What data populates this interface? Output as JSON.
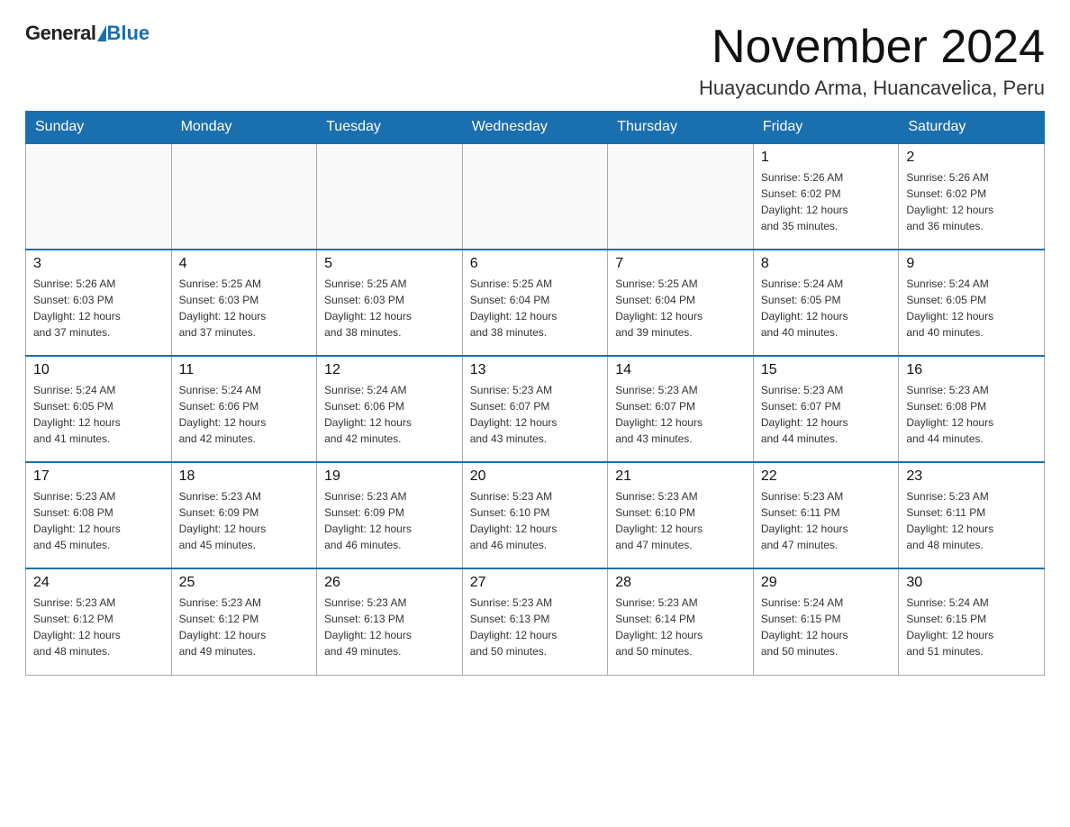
{
  "header": {
    "logo_general": "General",
    "logo_blue": "Blue",
    "main_title": "November 2024",
    "subtitle": "Huayacundo Arma, Huancavelica, Peru"
  },
  "calendar": {
    "days_of_week": [
      "Sunday",
      "Monday",
      "Tuesday",
      "Wednesday",
      "Thursday",
      "Friday",
      "Saturday"
    ],
    "weeks": [
      [
        {
          "num": "",
          "info": "",
          "empty": true
        },
        {
          "num": "",
          "info": "",
          "empty": true
        },
        {
          "num": "",
          "info": "",
          "empty": true
        },
        {
          "num": "",
          "info": "",
          "empty": true
        },
        {
          "num": "",
          "info": "",
          "empty": true
        },
        {
          "num": "1",
          "info": "Sunrise: 5:26 AM\nSunset: 6:02 PM\nDaylight: 12 hours\nand 35 minutes.",
          "empty": false
        },
        {
          "num": "2",
          "info": "Sunrise: 5:26 AM\nSunset: 6:02 PM\nDaylight: 12 hours\nand 36 minutes.",
          "empty": false
        }
      ],
      [
        {
          "num": "3",
          "info": "Sunrise: 5:26 AM\nSunset: 6:03 PM\nDaylight: 12 hours\nand 37 minutes.",
          "empty": false
        },
        {
          "num": "4",
          "info": "Sunrise: 5:25 AM\nSunset: 6:03 PM\nDaylight: 12 hours\nand 37 minutes.",
          "empty": false
        },
        {
          "num": "5",
          "info": "Sunrise: 5:25 AM\nSunset: 6:03 PM\nDaylight: 12 hours\nand 38 minutes.",
          "empty": false
        },
        {
          "num": "6",
          "info": "Sunrise: 5:25 AM\nSunset: 6:04 PM\nDaylight: 12 hours\nand 38 minutes.",
          "empty": false
        },
        {
          "num": "7",
          "info": "Sunrise: 5:25 AM\nSunset: 6:04 PM\nDaylight: 12 hours\nand 39 minutes.",
          "empty": false
        },
        {
          "num": "8",
          "info": "Sunrise: 5:24 AM\nSunset: 6:05 PM\nDaylight: 12 hours\nand 40 minutes.",
          "empty": false
        },
        {
          "num": "9",
          "info": "Sunrise: 5:24 AM\nSunset: 6:05 PM\nDaylight: 12 hours\nand 40 minutes.",
          "empty": false
        }
      ],
      [
        {
          "num": "10",
          "info": "Sunrise: 5:24 AM\nSunset: 6:05 PM\nDaylight: 12 hours\nand 41 minutes.",
          "empty": false
        },
        {
          "num": "11",
          "info": "Sunrise: 5:24 AM\nSunset: 6:06 PM\nDaylight: 12 hours\nand 42 minutes.",
          "empty": false
        },
        {
          "num": "12",
          "info": "Sunrise: 5:24 AM\nSunset: 6:06 PM\nDaylight: 12 hours\nand 42 minutes.",
          "empty": false
        },
        {
          "num": "13",
          "info": "Sunrise: 5:23 AM\nSunset: 6:07 PM\nDaylight: 12 hours\nand 43 minutes.",
          "empty": false
        },
        {
          "num": "14",
          "info": "Sunrise: 5:23 AM\nSunset: 6:07 PM\nDaylight: 12 hours\nand 43 minutes.",
          "empty": false
        },
        {
          "num": "15",
          "info": "Sunrise: 5:23 AM\nSunset: 6:07 PM\nDaylight: 12 hours\nand 44 minutes.",
          "empty": false
        },
        {
          "num": "16",
          "info": "Sunrise: 5:23 AM\nSunset: 6:08 PM\nDaylight: 12 hours\nand 44 minutes.",
          "empty": false
        }
      ],
      [
        {
          "num": "17",
          "info": "Sunrise: 5:23 AM\nSunset: 6:08 PM\nDaylight: 12 hours\nand 45 minutes.",
          "empty": false
        },
        {
          "num": "18",
          "info": "Sunrise: 5:23 AM\nSunset: 6:09 PM\nDaylight: 12 hours\nand 45 minutes.",
          "empty": false
        },
        {
          "num": "19",
          "info": "Sunrise: 5:23 AM\nSunset: 6:09 PM\nDaylight: 12 hours\nand 46 minutes.",
          "empty": false
        },
        {
          "num": "20",
          "info": "Sunrise: 5:23 AM\nSunset: 6:10 PM\nDaylight: 12 hours\nand 46 minutes.",
          "empty": false
        },
        {
          "num": "21",
          "info": "Sunrise: 5:23 AM\nSunset: 6:10 PM\nDaylight: 12 hours\nand 47 minutes.",
          "empty": false
        },
        {
          "num": "22",
          "info": "Sunrise: 5:23 AM\nSunset: 6:11 PM\nDaylight: 12 hours\nand 47 minutes.",
          "empty": false
        },
        {
          "num": "23",
          "info": "Sunrise: 5:23 AM\nSunset: 6:11 PM\nDaylight: 12 hours\nand 48 minutes.",
          "empty": false
        }
      ],
      [
        {
          "num": "24",
          "info": "Sunrise: 5:23 AM\nSunset: 6:12 PM\nDaylight: 12 hours\nand 48 minutes.",
          "empty": false
        },
        {
          "num": "25",
          "info": "Sunrise: 5:23 AM\nSunset: 6:12 PM\nDaylight: 12 hours\nand 49 minutes.",
          "empty": false
        },
        {
          "num": "26",
          "info": "Sunrise: 5:23 AM\nSunset: 6:13 PM\nDaylight: 12 hours\nand 49 minutes.",
          "empty": false
        },
        {
          "num": "27",
          "info": "Sunrise: 5:23 AM\nSunset: 6:13 PM\nDaylight: 12 hours\nand 50 minutes.",
          "empty": false
        },
        {
          "num": "28",
          "info": "Sunrise: 5:23 AM\nSunset: 6:14 PM\nDaylight: 12 hours\nand 50 minutes.",
          "empty": false
        },
        {
          "num": "29",
          "info": "Sunrise: 5:24 AM\nSunset: 6:15 PM\nDaylight: 12 hours\nand 50 minutes.",
          "empty": false
        },
        {
          "num": "30",
          "info": "Sunrise: 5:24 AM\nSunset: 6:15 PM\nDaylight: 12 hours\nand 51 minutes.",
          "empty": false
        }
      ]
    ]
  }
}
